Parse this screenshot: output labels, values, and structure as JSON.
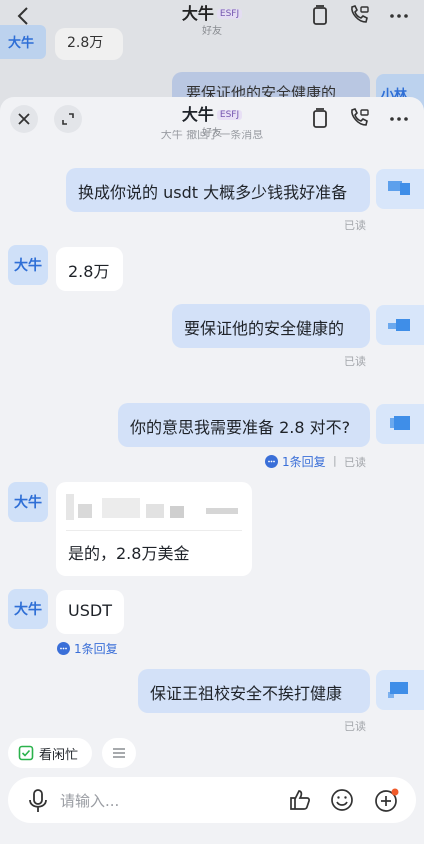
{
  "background": {
    "title": "大牛",
    "tag": "ESFJ",
    "subtitle": "好友",
    "left_avatar": "大牛",
    "left_msg": "2.8万",
    "right_msg": "要保证他的安全健康的",
    "right_avatar": "小林"
  },
  "header": {
    "title": "大牛",
    "tag": "ESFJ",
    "subtitle": "好友",
    "cut_notice": "大牛 撤回了一条消息"
  },
  "messages": {
    "m1": {
      "text": "换成你说的 usdt 大概多少钱我好准备",
      "status": "已读"
    },
    "m2": {
      "sender": "大牛",
      "text": "2.8万"
    },
    "m3": {
      "text": "要保证他的安全健康的",
      "status": "已读"
    },
    "m4": {
      "text": "你的意思我需要准备 2.8 对不?",
      "thread": "1条回复",
      "sep": "|",
      "status": "已读"
    },
    "m5": {
      "sender": "大牛",
      "text": "是的，2.8万美金"
    },
    "m6": {
      "sender": "大牛",
      "text": "USDT",
      "thread": "1条回复"
    },
    "m7": {
      "text": "保证王祖校安全不挨打健康",
      "status": "已读"
    }
  },
  "quick_bar": {
    "busy_label": "看闲忙"
  },
  "input": {
    "placeholder": "请输入..."
  },
  "colors": {
    "accent": "#3a6fd8",
    "bubble_right": "#d3e1f8",
    "bubble_left": "#ffffff",
    "notification": "#f05a2a"
  }
}
